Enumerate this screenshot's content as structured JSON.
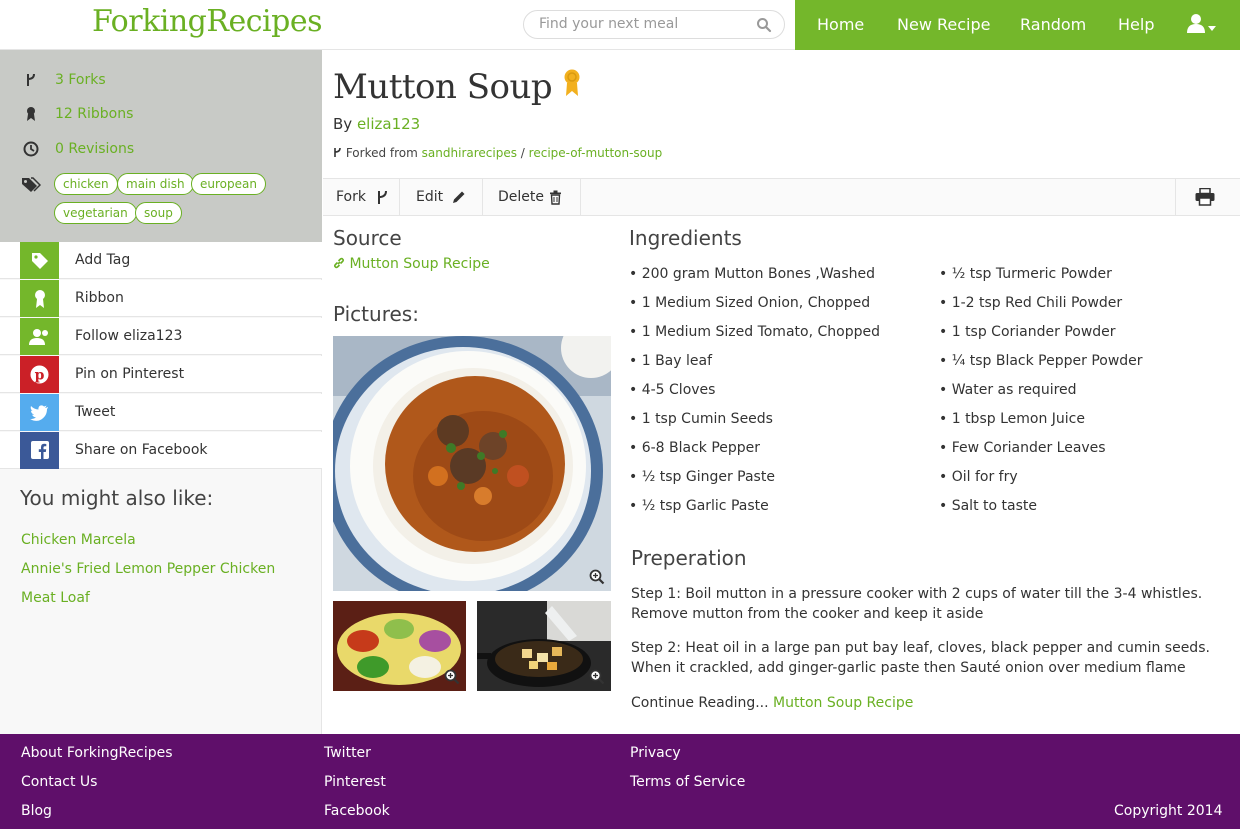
{
  "header": {
    "logo": "ForkingRecipes",
    "search_placeholder": "Find your next meal",
    "nav": [
      "Home",
      "New Recipe",
      "Random",
      "Help"
    ]
  },
  "sidebar": {
    "meta": {
      "forks": "3 Forks",
      "ribbons": "12 Ribbons",
      "revisions": "0 Revisions"
    },
    "tags": [
      "chicken",
      "main dish",
      "european",
      "vegetarian",
      "soup"
    ],
    "actions": [
      "Add Tag",
      "Ribbon",
      "Follow eliza123",
      "Pin on Pinterest",
      "Tweet",
      "Share on Facebook"
    ],
    "might_like_title": "You might also like:",
    "related": [
      "Chicken Marcela",
      "Annie's Fried Lemon Pepper Chicken",
      "Meat Loaf"
    ]
  },
  "recipe": {
    "title": "Mutton Soup",
    "by_label": "By",
    "author": "eliza123",
    "forked_label": "Forked from",
    "forked_user": "sandhirarecipes",
    "forked_sep": "/",
    "forked_recipe": "recipe-of-mutton-soup",
    "toolbar": {
      "fork": "Fork",
      "edit": "Edit",
      "delete": "Delete"
    },
    "source_title": "Source",
    "source_link": "Mutton Soup Recipe",
    "pictures_title": "Pictures:",
    "ingredients_title": "Ingredients",
    "ingredients_left": [
      "• 200 gram Mutton Bones ,Washed",
      "• 1 Medium Sized Onion, Chopped",
      "• 1 Medium Sized Tomato, Chopped",
      "• 1 Bay leaf",
      "• 4-5 Cloves",
      "• 1 tsp Cumin Seeds",
      "• 6-8 Black Pepper",
      "• ½ tsp Ginger Paste",
      "• ½ tsp Garlic Paste"
    ],
    "ingredients_right": [
      "• ½ tsp Turmeric Powder",
      "• 1-2 tsp Red Chili Powder",
      "• 1 tsp Coriander Powder",
      "• ¼ tsp Black Pepper Powder",
      "• Water as required",
      "• 1 tbsp Lemon Juice",
      "• Few Coriander Leaves",
      "• Oil for fry",
      "• Salt to taste"
    ],
    "preparation_title": "Preperation",
    "step1": "Step 1: Boil mutton in a pressure cooker with 2 cups of water till the 3-4 whistles. Remove mutton from the cooker and keep it aside",
    "step2": "Step 2: Heat oil in a large pan put bay leaf, cloves, black pepper and cumin seeds. When it crackled, add ginger-garlic paste then Sauté onion over medium flame",
    "continue_label": "Continue Reading...",
    "continue_link": "Mutton Soup Recipe"
  },
  "footer": {
    "col1": [
      "About ForkingRecipes",
      "Contact Us",
      "Blog"
    ],
    "col2": [
      "Twitter",
      "Pinterest",
      "Facebook"
    ],
    "col3": [
      "Privacy",
      "Terms of Service"
    ],
    "copyright": "Copyright 2014"
  },
  "colors": {
    "brand_green": "#74b72b",
    "footer_purple": "#5f0f6a",
    "pinterest": "#cb2027",
    "twitter": "#55acee",
    "facebook": "#3b5998",
    "ribbon_gold": "#f2b01e"
  }
}
